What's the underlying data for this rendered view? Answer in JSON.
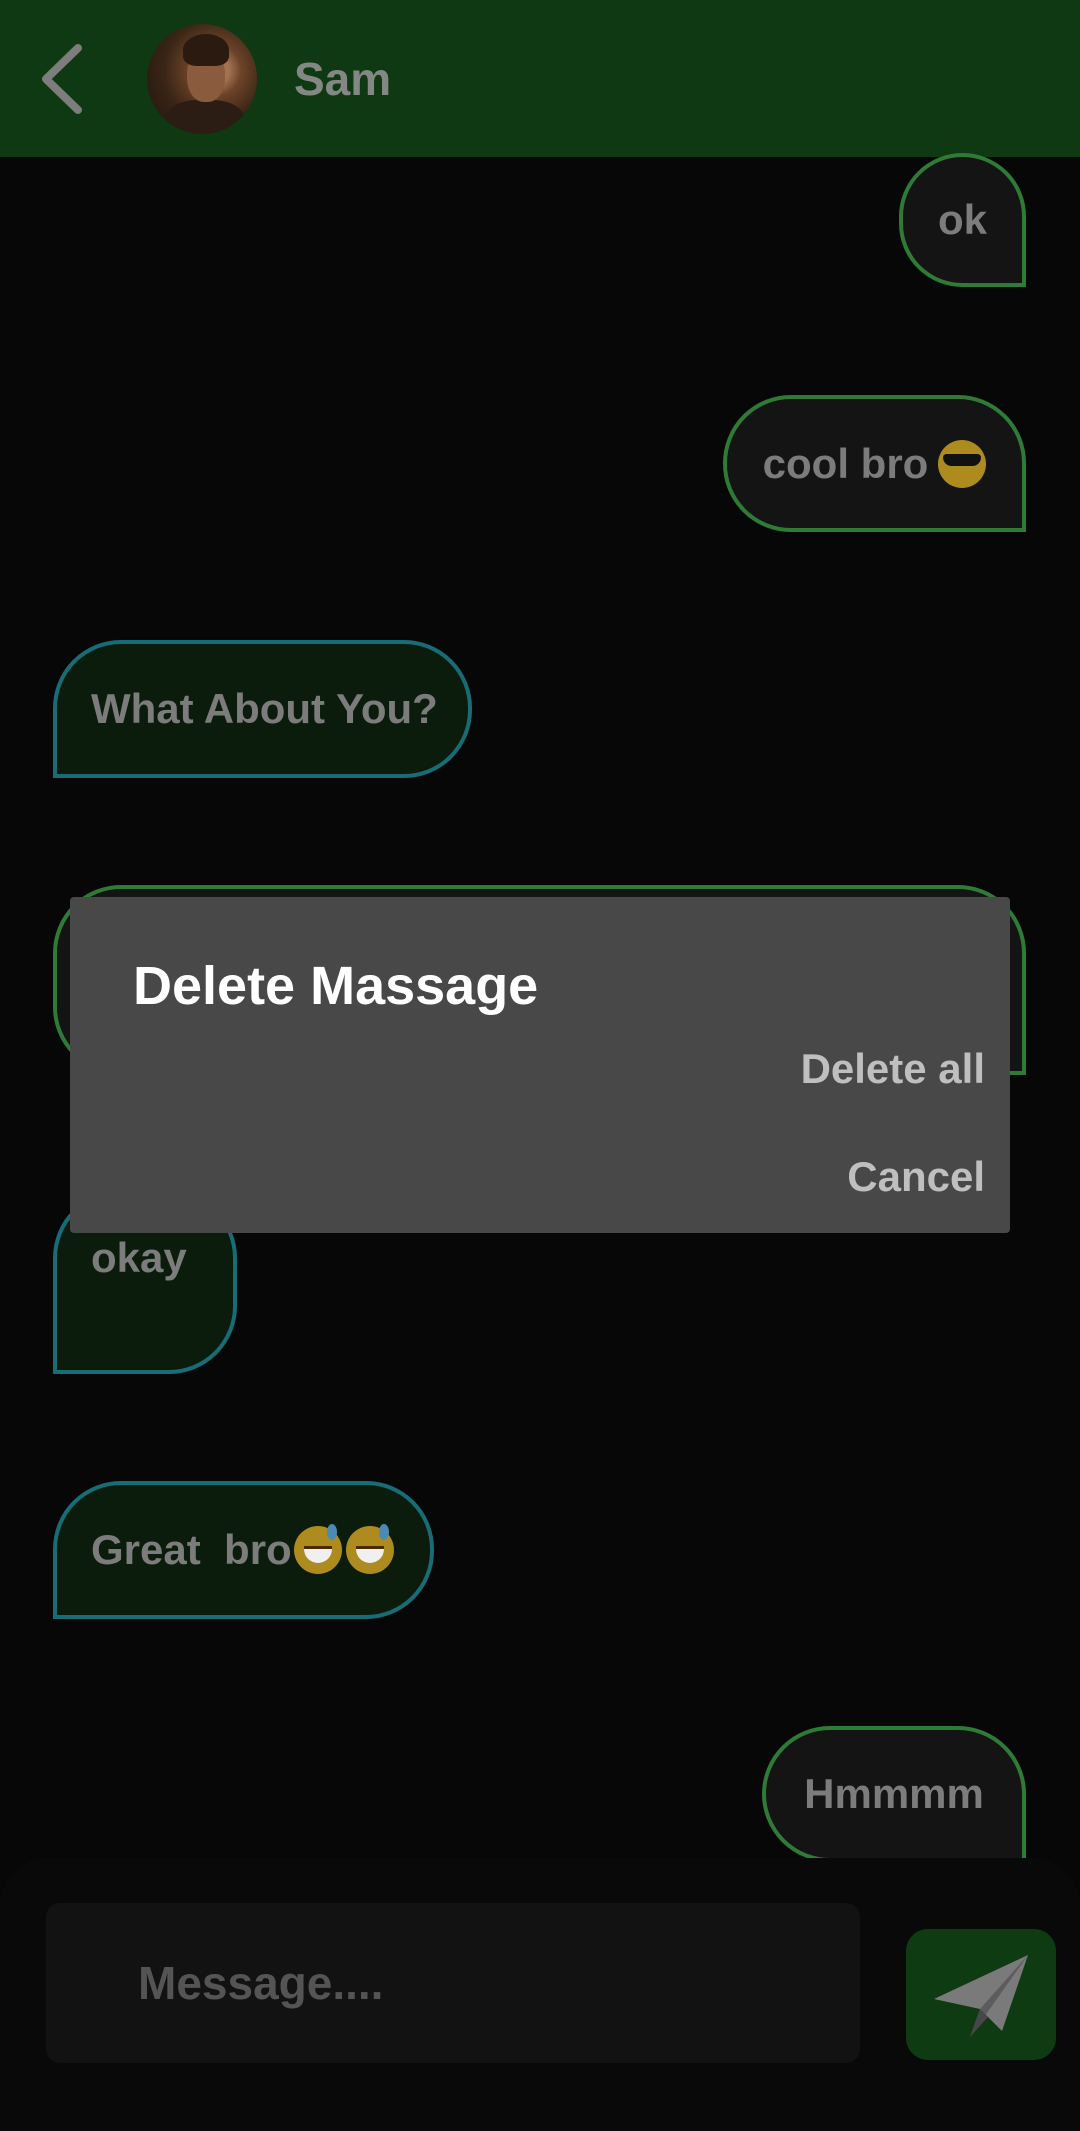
{
  "header": {
    "back_icon": "chevron-left-icon",
    "contact_name": "Sam",
    "avatar": "contact-avatar-photo"
  },
  "messages": [
    {
      "direction": "outgoing",
      "text": "ok"
    },
    {
      "direction": "outgoing",
      "text": "cool bro",
      "emoji": [
        "sunglasses-face"
      ]
    },
    {
      "direction": "incoming",
      "text": "What About You?"
    },
    {
      "direction": "outgoing",
      "text": ""
    },
    {
      "direction": "incoming",
      "text": "okay"
    },
    {
      "direction": "incoming",
      "text": "Great  bro",
      "emoji": [
        "grinning-sweat-face",
        "grinning-sweat-face"
      ]
    },
    {
      "direction": "outgoing",
      "text": "Hmmmm"
    }
  ],
  "composer": {
    "placeholder": "Message....",
    "value": "",
    "send_icon": "paper-plane-icon"
  },
  "dialog": {
    "title": "Delete Massage",
    "delete_all_label": "Delete all",
    "cancel_label": "Cancel"
  },
  "colors": {
    "header_bg": "#0f3912",
    "outgoing_border": "#2f7a35",
    "incoming_border": "#176c76",
    "dialog_bg": "#484848"
  }
}
